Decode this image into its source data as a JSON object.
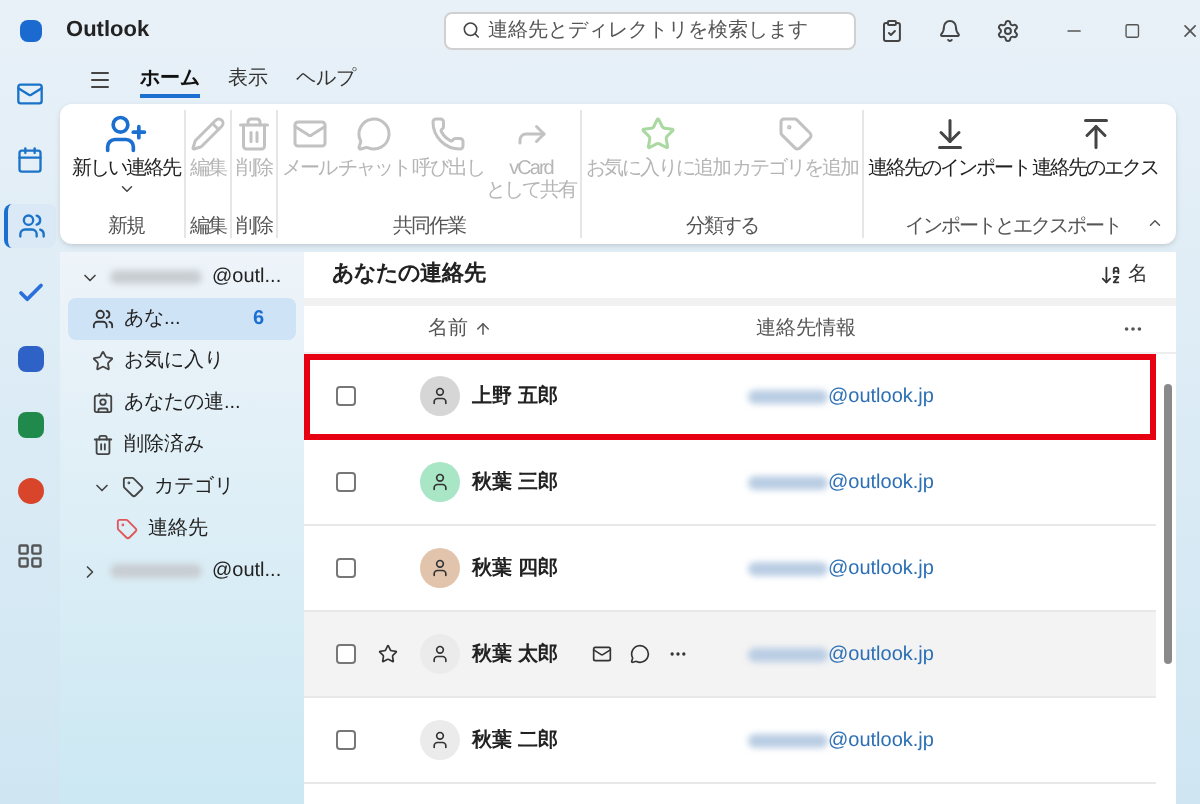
{
  "window": {
    "title": "Outlook"
  },
  "search": {
    "placeholder": "連絡先とディレクトリを検索します"
  },
  "rail": [
    {
      "kind": "mail",
      "selected": false
    },
    {
      "kind": "calendar",
      "selected": false
    },
    {
      "kind": "people",
      "selected": true
    },
    {
      "kind": "todo",
      "selected": false
    },
    {
      "kind": "teams",
      "selected": false
    },
    {
      "kind": "excel",
      "selected": false
    },
    {
      "kind": "powerpoint",
      "selected": false
    },
    {
      "kind": "apps",
      "selected": false
    }
  ],
  "menu_tabs": [
    {
      "label": "ホーム",
      "selected": true
    },
    {
      "label": "表示",
      "selected": false
    },
    {
      "label": "ヘルプ",
      "selected": false
    }
  ],
  "ribbon_groups": [
    {
      "label": "新規",
      "buttons": [
        {
          "kind": "new-contact",
          "label": "新しい連絡先",
          "disabled": false,
          "dropdown": true
        }
      ]
    },
    {
      "label": "編集",
      "buttons": [
        {
          "kind": "edit",
          "label": "編集",
          "disabled": true
        }
      ]
    },
    {
      "label": "削除",
      "buttons": [
        {
          "kind": "delete",
          "label": "削除",
          "disabled": true
        }
      ]
    },
    {
      "label": "共同作業",
      "buttons": [
        {
          "kind": "mail",
          "label": "メール",
          "disabled": true
        },
        {
          "kind": "chat",
          "label": "チャット",
          "disabled": true
        },
        {
          "kind": "call",
          "label": "呼び出し",
          "disabled": true
        },
        {
          "kind": "share",
          "label": "vCard",
          "label2": "として共有",
          "disabled": true
        }
      ]
    },
    {
      "label": "分類する",
      "buttons": [
        {
          "kind": "favorite",
          "label": "お気に入りに追加",
          "disabled": true
        },
        {
          "kind": "tag",
          "label": "カテゴリを追加",
          "disabled": true
        }
      ]
    },
    {
      "label": "インポートとエクスポート",
      "buttons": [
        {
          "kind": "import",
          "label": "連絡先のインポート",
          "disabled": false
        },
        {
          "kind": "export",
          "label": "連絡先のエクス",
          "disabled": false
        }
      ]
    }
  ],
  "folders": [
    {
      "kind": "account",
      "label": "@outl...",
      "expanded": true,
      "children": [
        {
          "kind": "contacts",
          "label": "あな...",
          "count": "6",
          "selected": true
        },
        {
          "kind": "favorites",
          "label": "お気に入り",
          "selected": false
        },
        {
          "kind": "people",
          "label": "あなたの連...",
          "selected": false
        },
        {
          "kind": "deleted",
          "label": "削除済み",
          "selected": false
        },
        {
          "kind": "categories",
          "label": "カテゴリ",
          "expanded": true,
          "selected": false,
          "children": [
            {
              "kind": "tag",
              "label": "連絡先",
              "selected": false
            }
          ]
        }
      ]
    },
    {
      "kind": "account",
      "label": "@outl...",
      "expanded": false
    }
  ],
  "list": {
    "title": "あなたの連絡先",
    "sort_label": "名",
    "columns": [
      "名前",
      "連絡先情報"
    ],
    "rows": [
      {
        "name": "上野 五郎",
        "email": "@outlook.jp",
        "color": "#d6d6d6",
        "highlighted": true,
        "hovered": false
      },
      {
        "name": "秋葉 三郎",
        "email": "@outlook.jp",
        "color": "#a8e6c6",
        "highlighted": false,
        "hovered": false
      },
      {
        "name": "秋葉 四郎",
        "email": "@outlook.jp",
        "color": "#e2c4ac",
        "highlighted": false,
        "hovered": false
      },
      {
        "name": "秋葉 太郎",
        "email": "@outlook.jp",
        "color": "#ebebeb",
        "highlighted": false,
        "hovered": true
      },
      {
        "name": "秋葉 二郎",
        "email": "@outlook.jp",
        "color": "#ebebeb",
        "highlighted": false,
        "hovered": false
      }
    ]
  }
}
